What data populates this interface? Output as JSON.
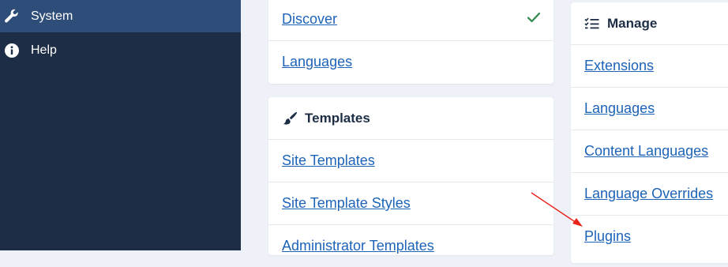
{
  "sidebar": {
    "items": [
      {
        "label": "System",
        "icon": "wrench-icon",
        "active": true
      },
      {
        "label": "Help",
        "icon": "info-circle-icon",
        "active": false
      }
    ]
  },
  "install_card": {
    "items": [
      {
        "label": "Discover",
        "checked": true
      },
      {
        "label": "Languages"
      }
    ]
  },
  "templates_card": {
    "title": "Templates",
    "icon": "paint-brush-icon",
    "items": [
      {
        "label": "Site Templates"
      },
      {
        "label": "Site Template Styles"
      },
      {
        "label": "Administrator Templates"
      }
    ]
  },
  "manage_card": {
    "title": "Manage",
    "icon": "list-check-icon",
    "items": [
      {
        "label": "Extensions"
      },
      {
        "label": "Languages"
      },
      {
        "label": "Content Languages"
      },
      {
        "label": "Language Overrides"
      },
      {
        "label": "Plugins"
      }
    ]
  },
  "colors": {
    "sidebar_bg": "#1c2d45",
    "sidebar_active": "#2e4d78",
    "link": "#1d63b8",
    "check": "#2f8a4c",
    "annotation_arrow": "#e8231c"
  }
}
